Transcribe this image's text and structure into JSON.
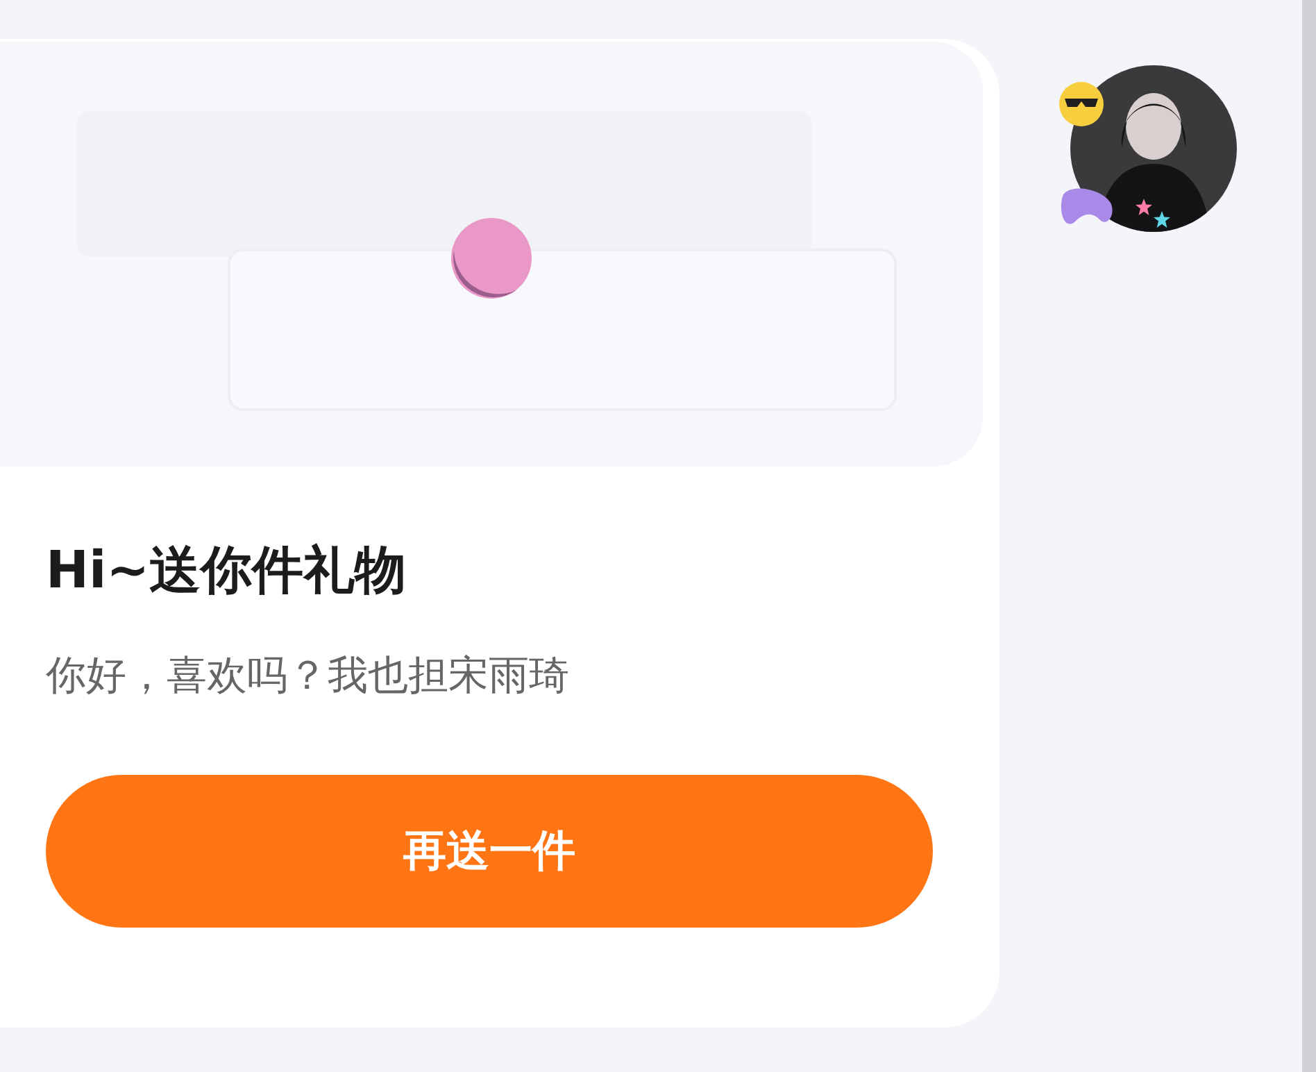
{
  "message": {
    "title": "Hi~送你件礼物",
    "text": "你好，喜欢吗？我也担宋雨琦",
    "button": "再送一件"
  }
}
